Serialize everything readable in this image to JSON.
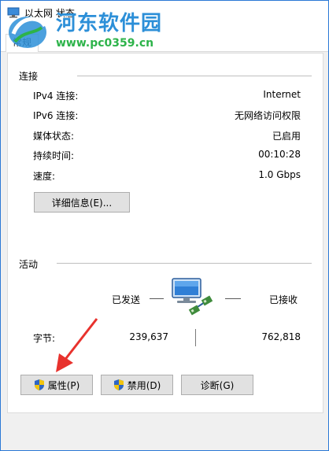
{
  "window": {
    "title": "以太网 状态",
    "tab": "常规"
  },
  "watermark": {
    "site": "河东软件园",
    "url": "www.pc0359.cn"
  },
  "connection": {
    "heading": "连接",
    "rows": [
      {
        "label": "IPv4 连接:",
        "value": "Internet"
      },
      {
        "label": "IPv6 连接:",
        "value": "无网络访问权限"
      },
      {
        "label": "媒体状态:",
        "value": "已启用"
      },
      {
        "label": "持续时间:",
        "value": "00:10:28"
      },
      {
        "label": "速度:",
        "value": "1.0 Gbps"
      }
    ],
    "details_button": "详细信息(E)..."
  },
  "activity": {
    "heading": "活动",
    "sent_label": "已发送",
    "received_label": "已接收",
    "bytes_label": "字节:",
    "bytes_sent": "239,637",
    "bytes_received": "762,818"
  },
  "buttons": {
    "properties": "属性(P)",
    "disable": "禁用(D)",
    "diagnose": "诊断(G)"
  },
  "colors": {
    "accent": "#2b79d6",
    "arrow": "#e8322d",
    "watermark_blue": "#2c8fd8",
    "watermark_green": "#2db34a"
  }
}
